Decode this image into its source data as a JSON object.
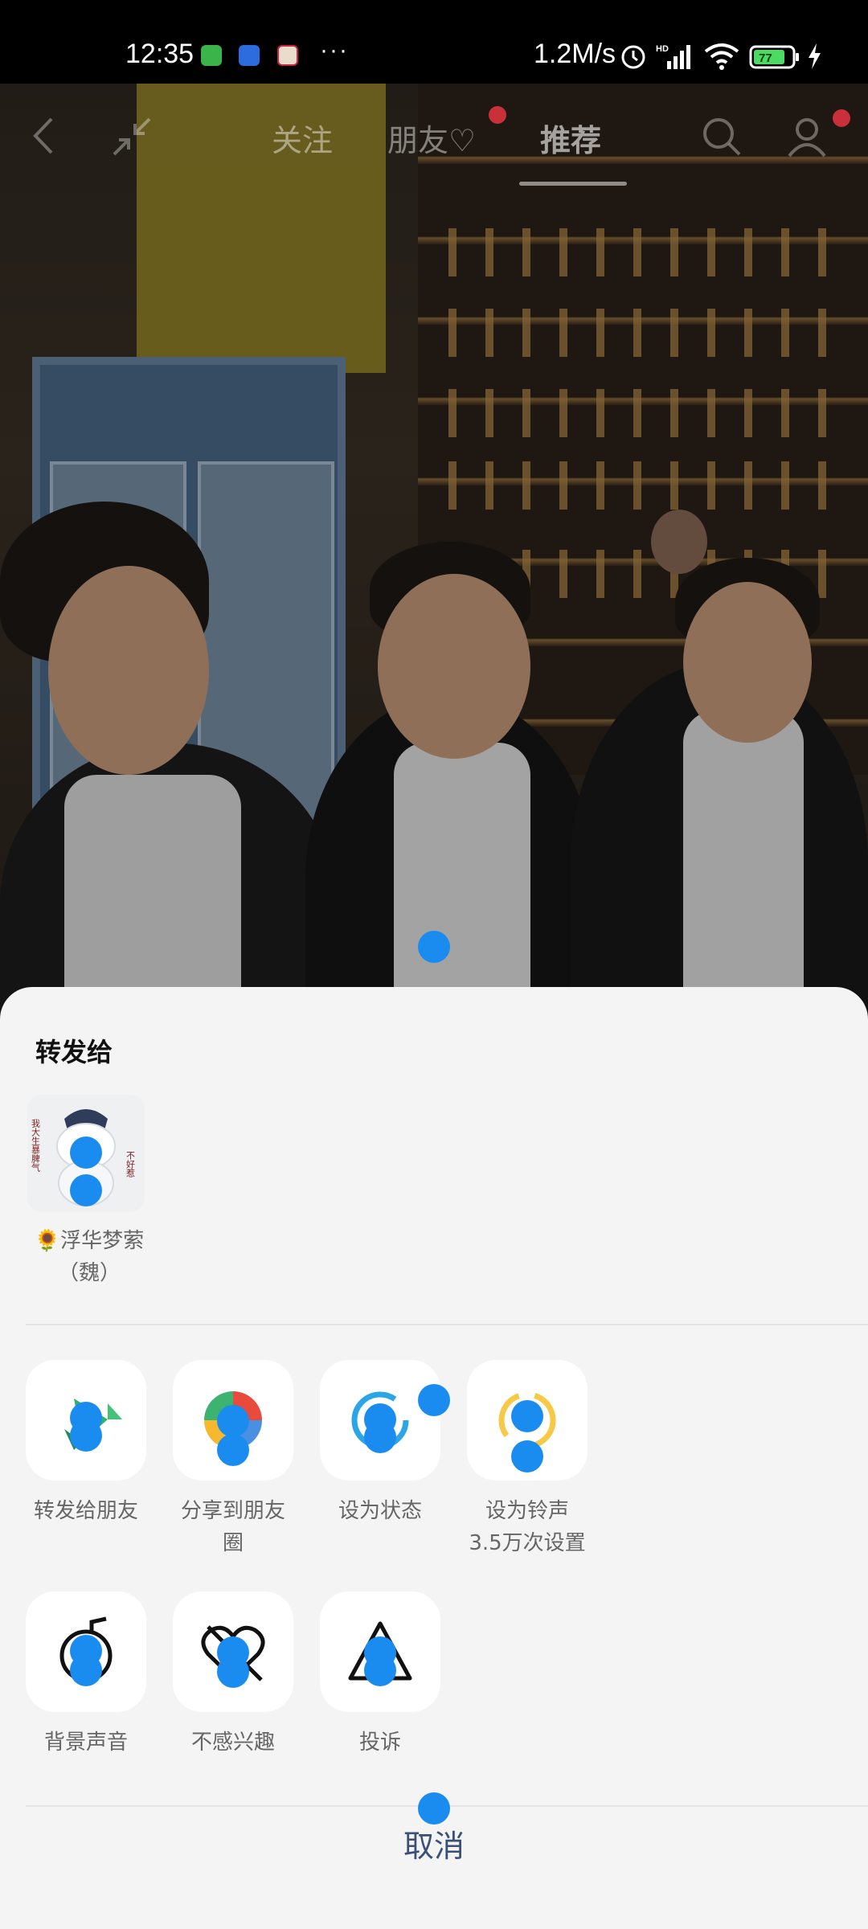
{
  "status_bar": {
    "time": "12:35",
    "dots": "···",
    "net_speed": "1.2M/s",
    "battery": "77",
    "icons": [
      "alarm-icon",
      "signal-icon",
      "wifi-icon",
      "battery-icon",
      "charging-icon"
    ]
  },
  "nav": {
    "tabs": [
      {
        "label": "关注"
      },
      {
        "label": "朋友♡"
      },
      {
        "label": "推荐"
      }
    ],
    "active_tab": "推荐"
  },
  "share_sheet": {
    "title": "转发给",
    "contacts": [
      {
        "name_line1": "🌻浮华梦萦",
        "name_line2": "（魏）",
        "avatar_text": "我大生暴脾气 不好惹"
      }
    ],
    "actions_row1": [
      {
        "line1": "转发给朋友",
        "line2": "",
        "icon": "forward-arrow-icon"
      },
      {
        "line1": "分享到朋友",
        "line2": "圈",
        "icon": "moments-aperture-icon"
      },
      {
        "line1": "设为状态",
        "line2": "",
        "icon": "status-ring-icon"
      },
      {
        "line1": "设为铃声",
        "line2": "3.5万次设置",
        "icon": "ringtone-icon"
      }
    ],
    "actions_row2": [
      {
        "line1": "背景声音",
        "line2": "",
        "icon": "music-note-icon"
      },
      {
        "line1": "不感兴趣",
        "line2": "",
        "icon": "not-interested-heart-icon"
      },
      {
        "line1": "投诉",
        "line2": "",
        "icon": "warning-triangle-icon"
      }
    ],
    "cancel": "取消"
  },
  "colors": {
    "touch_marker": "#1a8cf0",
    "sheet_bg": "#f4f4f5",
    "cancel_text": "#3a5077",
    "notification_dot": "#c9303a"
  }
}
